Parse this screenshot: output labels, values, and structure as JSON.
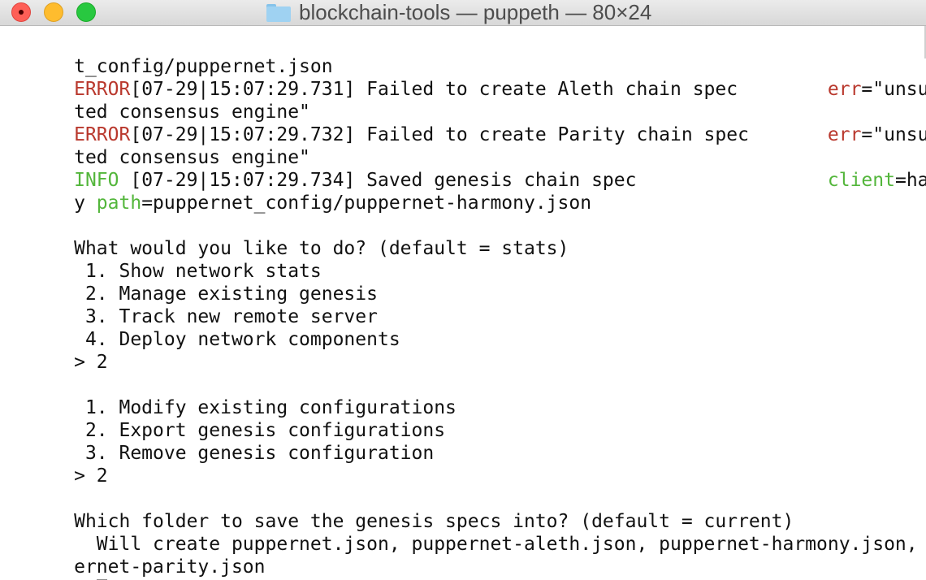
{
  "window": {
    "title": "blockchain-tools — puppeth — 80×24"
  },
  "icons": {
    "close": "close-icon",
    "minimize": "minimize-icon",
    "maximize": "maximize-icon",
    "folder": "folder-icon"
  },
  "colors": {
    "error": "#b9382d",
    "info": "#53b63b",
    "text": "#111111"
  },
  "terminal": {
    "l1": "t_config/puppernet.json",
    "l2_level": "ERROR",
    "l2_msg": "[07-29|15:07:29.731] Failed to create Aleth chain spec        ",
    "l2_key": "err",
    "l2_val": "=\"unsuppor",
    "l3": "ted consensus engine\"",
    "l4_level": "ERROR",
    "l4_msg": "[07-29|15:07:29.732] Failed to create Parity chain spec       ",
    "l4_key": "err",
    "l4_val": "=\"unsuppor",
    "l5": "ted consensus engine\"",
    "l6_level": "INFO ",
    "l6_msg": "[07-29|15:07:29.734] Saved genesis chain spec                 ",
    "l6_key": "client",
    "l6_val": "=harmon",
    "l7_pre": "y ",
    "l7_key": "path",
    "l7_val": "=puppernet_config/puppernet-harmony.json",
    "l9": "What would you like to do? (default = stats)",
    "l10": " 1. Show network stats",
    "l11": " 2. Manage existing genesis",
    "l12": " 3. Track new remote server",
    "l13": " 4. Deploy network components",
    "l14": "> 2",
    "l16": " 1. Modify existing configurations",
    "l17": " 2. Export genesis configurations",
    "l18": " 3. Remove genesis configuration",
    "l19": "> 2",
    "l21": "Which folder to save the genesis specs into? (default = current)",
    "l22": "  Will create puppernet.json, puppernet-aleth.json, puppernet-harmony.json, pupp",
    "l23": "ernet-parity.json",
    "l24": "> "
  }
}
